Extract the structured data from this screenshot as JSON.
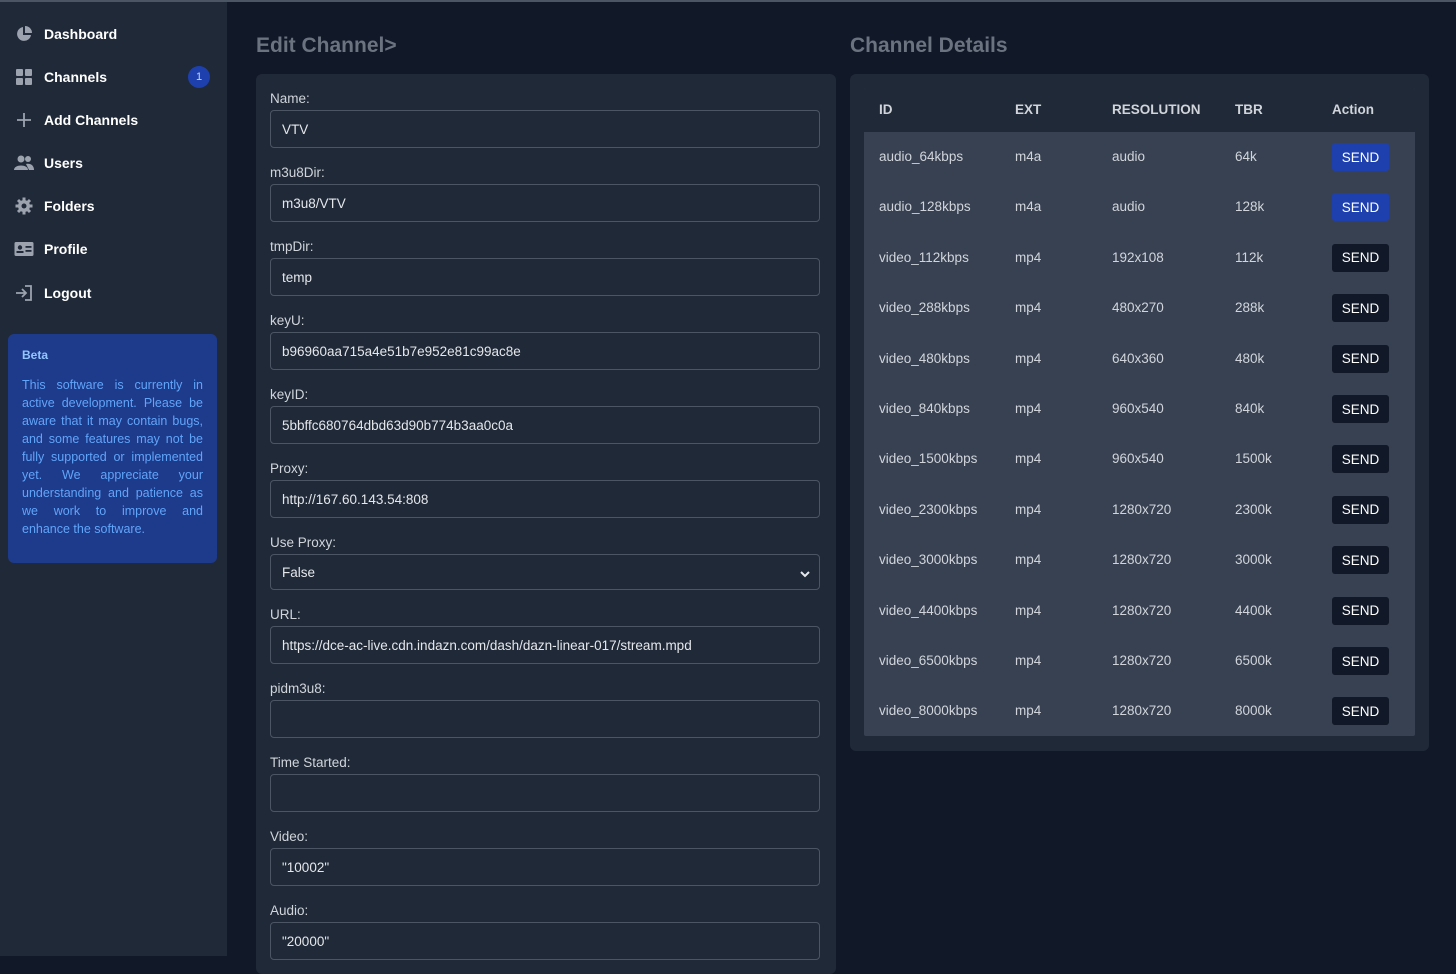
{
  "sidebar": {
    "items": [
      {
        "label": "Dashboard",
        "icon": "pie-chart-icon"
      },
      {
        "label": "Channels",
        "icon": "grid-icon",
        "badge": "1"
      },
      {
        "label": "Add Channels",
        "icon": "plus-icon"
      },
      {
        "label": "Users",
        "icon": "users-icon"
      },
      {
        "label": "Folders",
        "icon": "gear-icon"
      },
      {
        "label": "Profile",
        "icon": "id-card-icon"
      },
      {
        "label": "Logout",
        "icon": "logout-icon"
      }
    ],
    "beta": {
      "title": "Beta",
      "text": "This software is currently in active development. Please be aware that it may contain bugs, and some features may not be fully supported or implemented yet. We appreciate your understanding and patience as we work to improve and enhance the software."
    }
  },
  "edit": {
    "title": "Edit Channel>",
    "fields": [
      {
        "label": "Name:",
        "value": "VTV"
      },
      {
        "label": "m3u8Dir:",
        "value": "m3u8/VTV"
      },
      {
        "label": "tmpDir:",
        "value": "temp"
      },
      {
        "label": "keyU:",
        "value": "b96960aa715a4e51b7e952e81c99ac8e"
      },
      {
        "label": "keyID:",
        "value": "5bbffc680764dbd63d90b774b3aa0c0a"
      },
      {
        "label": "Proxy:",
        "value": "http://167.60.143.54:808"
      },
      {
        "label": "Use Proxy:",
        "value": "False"
      },
      {
        "label": "URL:",
        "value": "https://dce-ac-live.cdn.indazn.com/dash/dazn-linear-017/stream.mpd"
      },
      {
        "label": "pidm3u8:",
        "value": ""
      },
      {
        "label": "Time Started:",
        "value": ""
      },
      {
        "label": "Video:",
        "value": "\"10002\""
      },
      {
        "label": "Audio:",
        "value": "\"20000\""
      }
    ]
  },
  "details": {
    "title": "Channel Details",
    "headers": [
      "ID",
      "EXT",
      "RESOLUTION",
      "TBR",
      "Action"
    ],
    "rows": [
      {
        "id": "audio_64kbps",
        "ext": "m4a",
        "res": "audio",
        "tbr": "64k",
        "action": "SEND"
      },
      {
        "id": "audio_128kbps",
        "ext": "m4a",
        "res": "audio",
        "tbr": "128k",
        "action": "SEND"
      },
      {
        "id": "video_112kbps",
        "ext": "mp4",
        "res": "192x108",
        "tbr": "112k",
        "action": "SEND"
      },
      {
        "id": "video_288kbps",
        "ext": "mp4",
        "res": "480x270",
        "tbr": "288k",
        "action": "SEND"
      },
      {
        "id": "video_480kbps",
        "ext": "mp4",
        "res": "640x360",
        "tbr": "480k",
        "action": "SEND"
      },
      {
        "id": "video_840kbps",
        "ext": "mp4",
        "res": "960x540",
        "tbr": "840k",
        "action": "SEND"
      },
      {
        "id": "video_1500kbps",
        "ext": "mp4",
        "res": "960x540",
        "tbr": "1500k",
        "action": "SEND"
      },
      {
        "id": "video_2300kbps",
        "ext": "mp4",
        "res": "1280x720",
        "tbr": "2300k",
        "action": "SEND"
      },
      {
        "id": "video_3000kbps",
        "ext": "mp4",
        "res": "1280x720",
        "tbr": "3000k",
        "action": "SEND"
      },
      {
        "id": "video_4400kbps",
        "ext": "mp4",
        "res": "1280x720",
        "tbr": "4400k",
        "action": "SEND"
      },
      {
        "id": "video_6500kbps",
        "ext": "mp4",
        "res": "1280x720",
        "tbr": "6500k",
        "action": "SEND"
      },
      {
        "id": "video_8000kbps",
        "ext": "mp4",
        "res": "1280x720",
        "tbr": "8000k",
        "action": "SEND"
      }
    ]
  },
  "colors": {
    "background": "#111827",
    "panel": "#1f2937",
    "accent": "#1e40af",
    "beta_bg": "#1e3a8a"
  }
}
